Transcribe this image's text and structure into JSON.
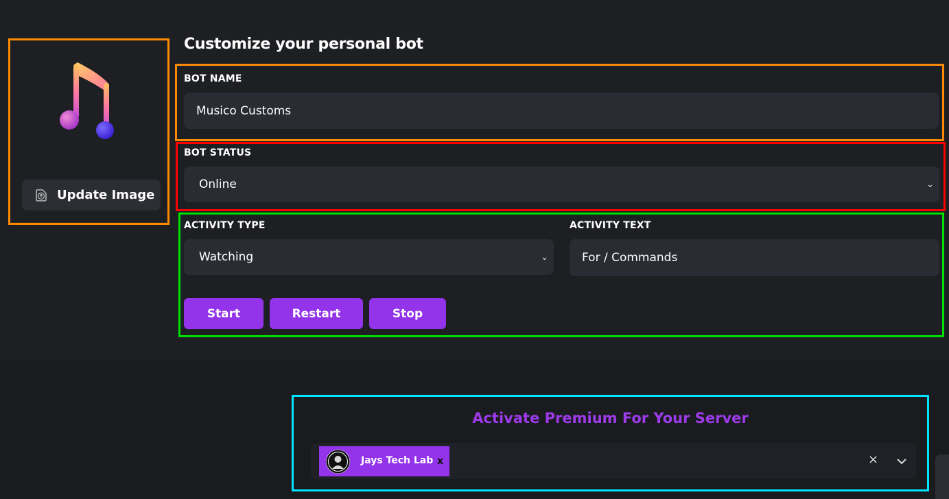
{
  "avatar": {
    "icon": "music-note-icon",
    "update_label": "Update Image"
  },
  "page": {
    "title": "Customize your personal bot"
  },
  "bot_name": {
    "label": "BOT NAME",
    "value": "Musico Customs"
  },
  "bot_status": {
    "label": "BOT STATUS",
    "value": "Online"
  },
  "activity": {
    "type_label": "ACTIVITY TYPE",
    "type_value": "Watching",
    "text_label": "ACTIVITY TEXT",
    "text_value": "For / Commands"
  },
  "actions": {
    "start": "Start",
    "restart": "Restart",
    "stop": "Stop"
  },
  "premium": {
    "title": "Activate Premium For Your Server",
    "selected_server": "Jays Tech Lab",
    "remove_symbol": "x",
    "clear_symbol": "×"
  },
  "colors": {
    "accent": "#9333ea",
    "background": "#1e1f23",
    "field": "#2a2c33"
  }
}
